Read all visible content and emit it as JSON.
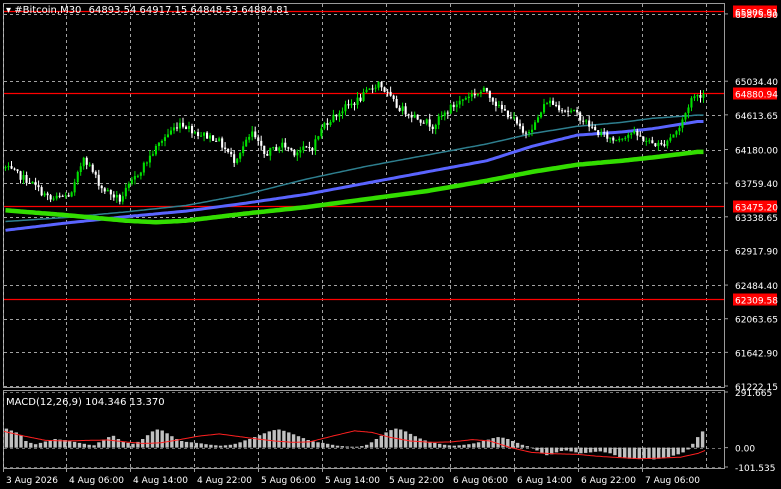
{
  "header": {
    "symbol_label": "#Bitcoin,M30",
    "ohlc_text": "64893.54 64917.15 64848.53 64884.81"
  },
  "macd_label": "MACD(12,26,9) 104.346 13.370",
  "colors": {
    "background": "#000000",
    "grid": "#bfbfbf",
    "bull_candle": "#00e000",
    "bear_candle": "#ffffff",
    "level_line": "#ff0000",
    "level_tag_bg": "#ff0000",
    "ma_fast": "#2e7f8f",
    "ma_mid": "#5a64ff",
    "ma_slow": "#33dd00",
    "macd_hist": "#c0c0c0",
    "macd_signal": "#ff2020",
    "text": "#ffffff"
  },
  "chart_data": {
    "type": "candlestick",
    "price_axis_ticks": [
      "65875.90",
      "65034.40",
      "64613.65",
      "64180.00",
      "63759.40",
      "63338.65",
      "62917.90",
      "62484.40",
      "62063.65",
      "61642.90",
      "61222.15"
    ],
    "price_ylim": [
      61222.15,
      66000.0
    ],
    "horizontal_levels": [
      "65906.91",
      "64880.94",
      "63475.20",
      "62309.58"
    ],
    "time_axis_labels": [
      "3 Aug 2026",
      "4 Aug 06:00",
      "4 Aug 14:00",
      "4 Aug 22:00",
      "5 Aug 06:00",
      "5 Aug 14:00",
      "5 Aug 22:00",
      "6 Aug 06:00",
      "6 Aug 14:00",
      "6 Aug 22:00",
      "7 Aug 06:00"
    ],
    "macd_axis_ticks": [
      "291.665",
      "0.00",
      "-101.535"
    ],
    "macd_ylim": [
      -101.535,
      291.665
    ],
    "moving_averages": [
      {
        "color_key": "ma_fast",
        "points": [
          [
            0,
            63280
          ],
          [
            20,
            63330
          ],
          [
            40,
            63400
          ],
          [
            60,
            63480
          ],
          [
            80,
            63620
          ],
          [
            100,
            63810
          ],
          [
            120,
            63970
          ],
          [
            140,
            64110
          ],
          [
            160,
            64250
          ],
          [
            175,
            64380
          ],
          [
            190,
            64470
          ],
          [
            205,
            64520
          ],
          [
            215,
            64570
          ],
          [
            230,
            64610
          ]
        ]
      },
      {
        "color_key": "ma_mid",
        "points": [
          [
            0,
            63170
          ],
          [
            20,
            63260
          ],
          [
            40,
            63340
          ],
          [
            60,
            63410
          ],
          [
            80,
            63510
          ],
          [
            100,
            63620
          ],
          [
            120,
            63760
          ],
          [
            140,
            63900
          ],
          [
            160,
            64040
          ],
          [
            175,
            64220
          ],
          [
            190,
            64360
          ],
          [
            205,
            64400
          ],
          [
            215,
            64440
          ],
          [
            230,
            64530
          ]
        ]
      },
      {
        "color_key": "ma_slow",
        "points": [
          [
            0,
            63420
          ],
          [
            20,
            63360
          ],
          [
            40,
            63290
          ],
          [
            50,
            63270
          ],
          [
            60,
            63290
          ],
          [
            80,
            63380
          ],
          [
            100,
            63460
          ],
          [
            120,
            63560
          ],
          [
            140,
            63660
          ],
          [
            160,
            63790
          ],
          [
            175,
            63900
          ],
          [
            190,
            63990
          ],
          [
            205,
            64040
          ],
          [
            215,
            64080
          ],
          [
            230,
            64150
          ]
        ]
      }
    ],
    "price_path": [
      [
        0,
        63950
      ],
      [
        8,
        63780
      ],
      [
        15,
        63550
      ],
      [
        22,
        63620
      ],
      [
        26,
        64100
      ],
      [
        32,
        63700
      ],
      [
        38,
        63550
      ],
      [
        44,
        63880
      ],
      [
        52,
        64300
      ],
      [
        58,
        64520
      ],
      [
        64,
        64380
      ],
      [
        70,
        64320
      ],
      [
        76,
        64050
      ],
      [
        82,
        64380
      ],
      [
        86,
        64120
      ],
      [
        92,
        64240
      ],
      [
        96,
        64150
      ],
      [
        102,
        64210
      ],
      [
        106,
        64500
      ],
      [
        112,
        64680
      ],
      [
        118,
        64820
      ],
      [
        124,
        65020
      ],
      [
        130,
        64720
      ],
      [
        136,
        64600
      ],
      [
        142,
        64480
      ],
      [
        148,
        64700
      ],
      [
        154,
        64860
      ],
      [
        160,
        64920
      ],
      [
        164,
        64700
      ],
      [
        168,
        64600
      ],
      [
        172,
        64380
      ],
      [
        176,
        64500
      ],
      [
        180,
        64790
      ],
      [
        186,
        64680
      ],
      [
        190,
        64620
      ],
      [
        196,
        64410
      ],
      [
        202,
        64300
      ],
      [
        208,
        64390
      ],
      [
        214,
        64270
      ],
      [
        218,
        64230
      ],
      [
        224,
        64450
      ],
      [
        228,
        64820
      ],
      [
        232,
        64884
      ]
    ],
    "macd_hist": [
      100,
      90,
      80,
      65,
      35,
      25,
      18,
      25,
      32,
      38,
      45,
      42,
      40,
      35,
      30,
      25,
      20,
      15,
      12,
      28,
      42,
      55,
      62,
      45,
      32,
      25,
      20,
      30,
      45,
      65,
      85,
      95,
      90,
      75,
      60,
      45,
      35,
      30,
      28,
      25,
      22,
      18,
      15,
      12,
      10,
      12,
      15,
      20,
      28,
      38,
      45,
      55,
      65,
      75,
      85,
      92,
      95,
      88,
      80,
      70,
      60,
      50,
      40,
      32,
      28,
      25,
      20,
      15,
      10,
      8,
      6,
      5,
      5,
      8,
      15,
      28,
      45,
      62,
      80,
      92,
      100,
      95,
      85,
      72,
      60,
      48,
      38,
      30,
      25,
      20,
      15,
      12,
      10,
      12,
      15,
      18,
      22,
      28,
      35,
      42,
      50,
      55,
      52,
      45,
      35,
      25,
      15,
      8,
      0,
      -15,
      -30,
      -40,
      -35,
      -25,
      -18,
      -15,
      -20,
      -25,
      -30,
      -28,
      -25,
      -22,
      -20,
      -25,
      -30,
      -40,
      -50,
      -55,
      -58,
      -60,
      -58,
      -55,
      -60,
      -62,
      -58,
      -55,
      -50,
      -42,
      -35,
      -25,
      -10,
      20,
      55,
      85
    ],
    "macd_signal": [
      [
        0,
        85
      ],
      [
        12,
        60
      ],
      [
        24,
        38
      ],
      [
        36,
        35
      ],
      [
        48,
        38
      ],
      [
        60,
        40
      ],
      [
        70,
        30
      ],
      [
        80,
        22
      ],
      [
        90,
        25
      ],
      [
        100,
        40
      ],
      [
        112,
        60
      ],
      [
        124,
        72
      ],
      [
        134,
        60
      ],
      [
        146,
        45
      ],
      [
        156,
        35
      ],
      [
        166,
        28
      ],
      [
        176,
        30
      ],
      [
        190,
        62
      ],
      [
        202,
        88
      ],
      [
        212,
        80
      ],
      [
        222,
        55
      ],
      [
        234,
        35
      ],
      [
        246,
        28
      ],
      [
        258,
        30
      ],
      [
        270,
        42
      ],
      [
        280,
        35
      ],
      [
        292,
        0
      ],
      [
        304,
        -25
      ],
      [
        316,
        -32
      ],
      [
        330,
        -35
      ],
      [
        342,
        -45
      ],
      [
        354,
        -52
      ],
      [
        366,
        -58
      ],
      [
        378,
        -55
      ],
      [
        390,
        -50
      ],
      [
        400,
        -30
      ],
      [
        404,
        -15
      ]
    ]
  }
}
